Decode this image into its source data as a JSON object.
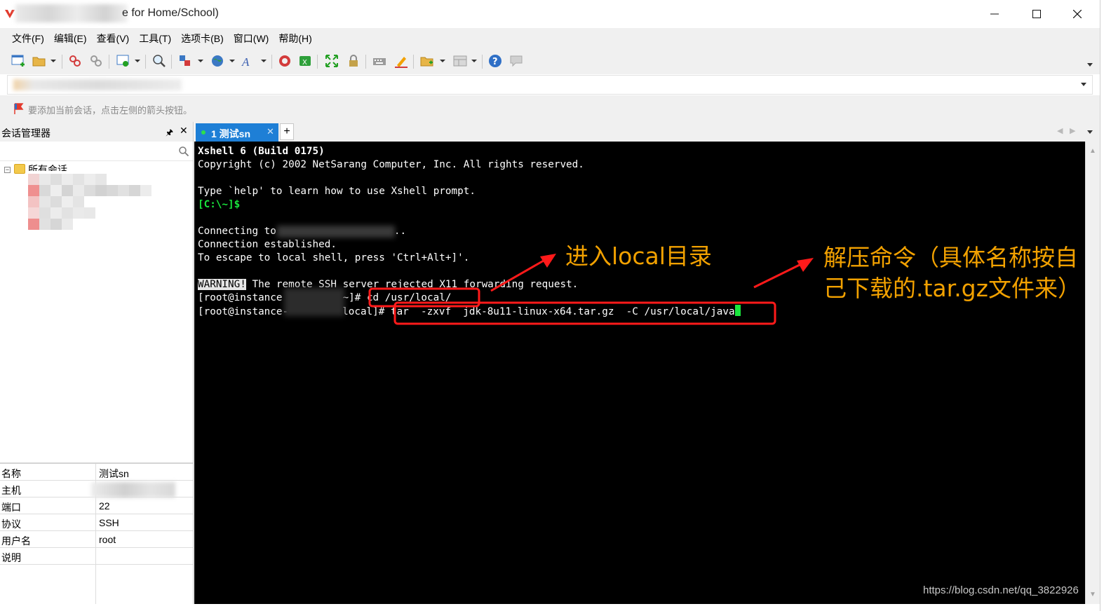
{
  "window": {
    "title_visible": "e for Home/School)",
    "controls": {
      "minimize": "—",
      "maximize": "☐",
      "close": "✕"
    }
  },
  "menu": [
    "文件(F)",
    "编辑(E)",
    "查看(V)",
    "工具(T)",
    "选项卡(B)",
    "窗口(W)",
    "帮助(H)"
  ],
  "hint": {
    "text": "要添加当前会话，点击左侧的箭头按钮。"
  },
  "session_manager": {
    "title": "会话管理器",
    "pin": "🖈",
    "close": "✕",
    "tree_root": "所有会话",
    "tree_toggle": "−",
    "properties": [
      {
        "key": "名称",
        "value": "测试sn"
      },
      {
        "key": "主机",
        "value": ""
      },
      {
        "key": "端口",
        "value": "22"
      },
      {
        "key": "协议",
        "value": "SSH"
      },
      {
        "key": "用户名",
        "value": "root"
      },
      {
        "key": "说明",
        "value": ""
      }
    ]
  },
  "tabs": {
    "active_label": "1 测试sn",
    "close": "✕",
    "add": "+",
    "prev": "◀",
    "next": "▶"
  },
  "terminal": {
    "lines": {
      "l1": "Xshell 6 (Build 0175)",
      "l2": "Copyright (c) 2002 NetSarang Computer, Inc. All rights reserved.",
      "l3": "Type `help' to learn how to use Xshell prompt.",
      "l4": "[C:\\~]$",
      "l5a": "Connecting to",
      "l5b": "..",
      "l6": "Connection established.",
      "l7": "To escape to local shell, press 'Ctrl+Alt+]'.",
      "l8a": "WARNING!",
      "l8b": " The remote SSH server rejected X11 forwarding request.",
      "l9a": "[root@instance",
      "l9b": "~]# cd /usr/local/",
      "l10a": "[root@instance-",
      "l10b": "local]# tar  -zxvf  jdk-8u11-linux-x64.tar.gz  -C /usr/local/java"
    },
    "colors": {
      "background": "#000000",
      "text": "#ffffff",
      "prompt": "#19e63c",
      "cursor": "#19e63c"
    }
  },
  "annotations": {
    "note1": "进入local目录",
    "note2_line1": "解压命令（具体名称按自",
    "note2_line2": "己下载的.tar.gz文件来）",
    "color_box": "#ff0000",
    "color_text": "#f2a100"
  },
  "watermark": "https://blog.csdn.net/qq_3822926",
  "icons": [
    "new-session-icon",
    "open-folder-icon",
    "connect-icon",
    "disconnect-icon",
    "properties-icon",
    "find-icon",
    "transfer-icon",
    "globe-icon",
    "font-icon",
    "xftp-icon",
    "xshell-green-icon",
    "fullscreen-icon",
    "lock-icon",
    "keyboard-icon",
    "highlight-icon",
    "new-folder-icon",
    "layout-icon",
    "help-icon",
    "chat-icon"
  ]
}
